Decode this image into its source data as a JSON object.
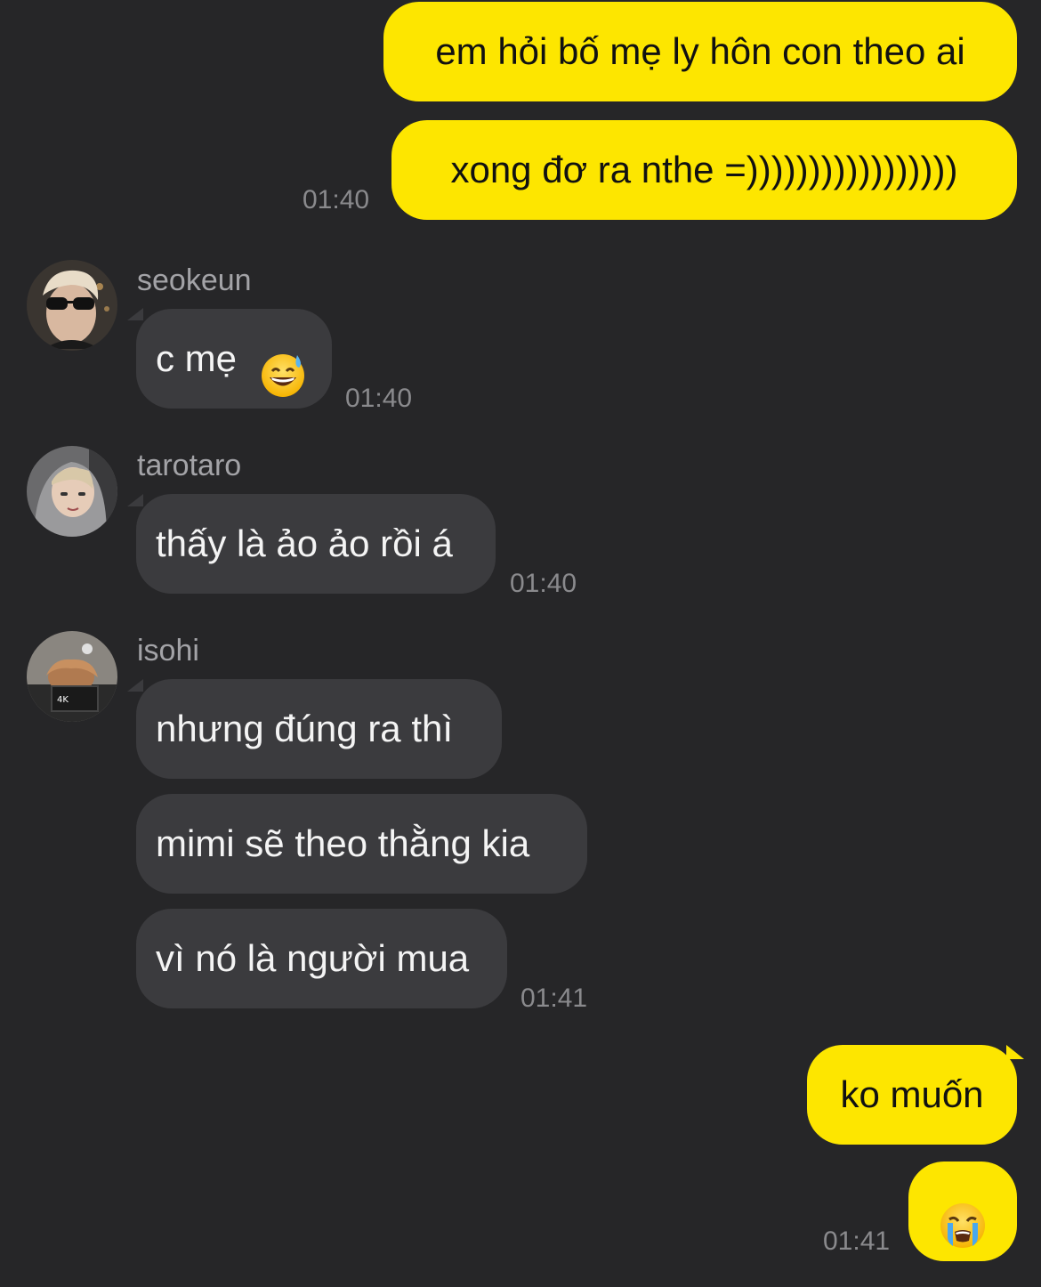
{
  "colors": {
    "background": "#262628",
    "outgoing_bubble": "#fde600",
    "incoming_bubble": "#3b3b3e",
    "timestamp": "#8a8a8d",
    "sender_name": "#a3a3a7"
  },
  "messages": {
    "out1": {
      "text": "em hỏi bố mẹ ly hôn con theo ai"
    },
    "out2": {
      "text": "xong đơ ra nthe =)))))))))))))))))",
      "time": "01:40"
    },
    "seokeun": {
      "sender": "seokeun",
      "text": "c mẹ",
      "emoji": "grinning-face-with-sweat",
      "time": "01:40"
    },
    "tarotaro": {
      "sender": "tarotaro",
      "text": "thấy là ảo ảo rồi á",
      "time": "01:40"
    },
    "isohi": {
      "sender": "isohi",
      "lines": [
        "nhưng đúng ra thì",
        "mimi sẽ theo thằng kia",
        "vì nó là người mua"
      ],
      "time": "01:41"
    },
    "out3": {
      "text": "ko muốn"
    },
    "out4": {
      "emoji": "loudly-crying-face",
      "time": "01:41"
    }
  }
}
